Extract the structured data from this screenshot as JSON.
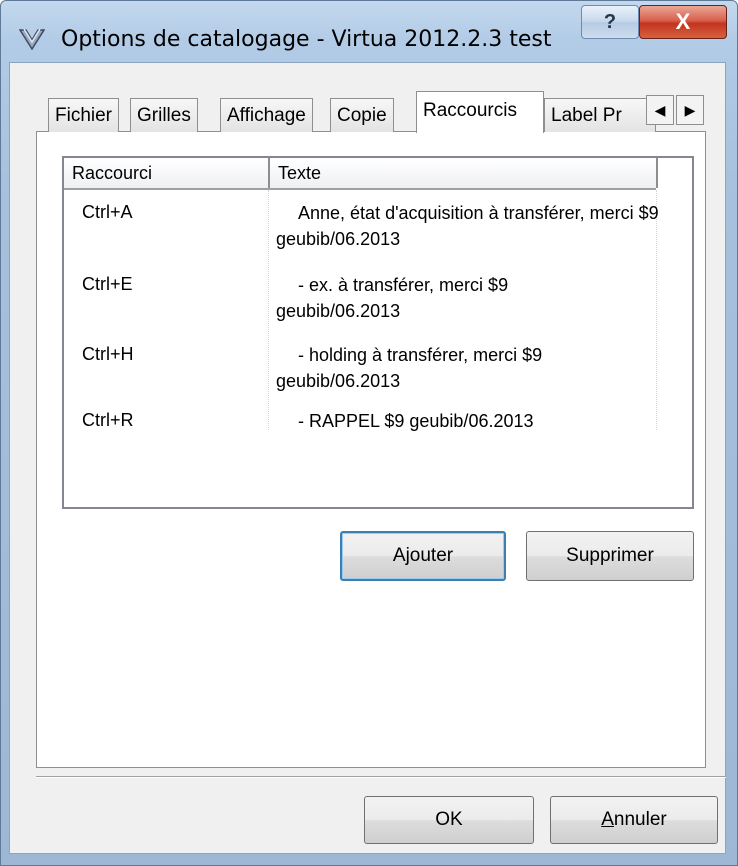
{
  "window": {
    "title": "Options de catalogage - Virtua 2012.2.3 test",
    "help_label": "?",
    "close_label": "X"
  },
  "tabs": [
    {
      "label": "Fichier"
    },
    {
      "label": "Grilles"
    },
    {
      "label": "Affichage"
    },
    {
      "label": "Copie"
    },
    {
      "label": "Raccourcis",
      "active": true
    },
    {
      "label": "Label Pr"
    }
  ],
  "tab_scroll": {
    "left": "◀",
    "right": "▶"
  },
  "list": {
    "columns": [
      "Raccourci",
      "Texte"
    ],
    "rows": [
      {
        "shortcut": "Ctrl+A",
        "text": "Anne, état d'acquisition à transférer, merci $9 geubib/06.2013"
      },
      {
        "shortcut": "Ctrl+E",
        "text": "- ex. à transférer, merci $9 geubib/06.2013"
      },
      {
        "shortcut": "Ctrl+H",
        "text": "- holding à transférer, merci $9 geubib/06.2013"
      },
      {
        "shortcut": "Ctrl+R",
        "text": "- RAPPEL $9 geubib/06.2013"
      }
    ]
  },
  "buttons": {
    "add": "Ajouter",
    "delete": "Supprimer",
    "ok": "OK",
    "cancel_mnemonic": "A",
    "cancel_rest": "nnuler"
  }
}
